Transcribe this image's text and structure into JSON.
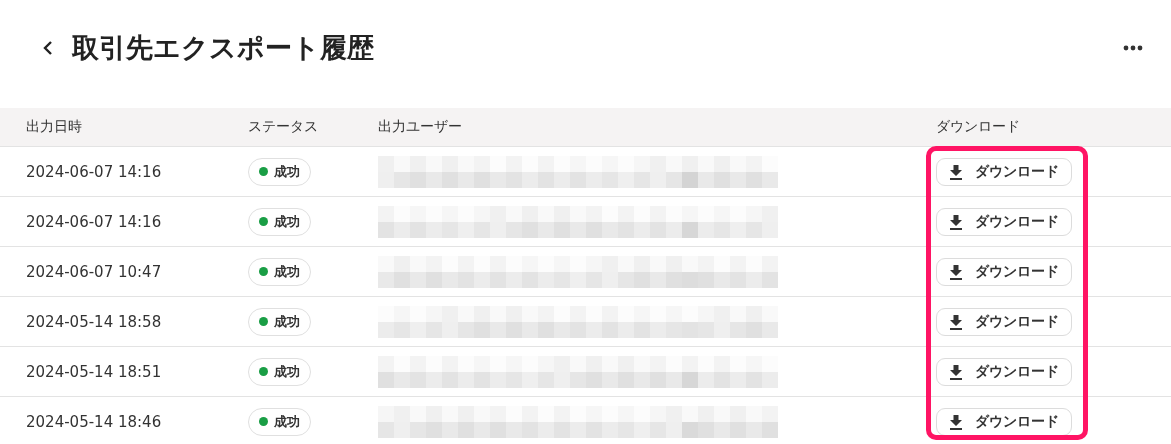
{
  "header": {
    "title": "取引先エクスポート履歴"
  },
  "table": {
    "columns": [
      "出力日時",
      "ステータス",
      "出力ユーザー",
      "ダウンロード"
    ],
    "rows": [
      {
        "date": "2024-06-07 14:16",
        "status": {
          "label": "成功",
          "kind": "success"
        },
        "download": "ダウンロード"
      },
      {
        "date": "2024-06-07 14:16",
        "status": {
          "label": "成功",
          "kind": "success"
        },
        "download": "ダウンロード"
      },
      {
        "date": "2024-06-07 10:47",
        "status": {
          "label": "成功",
          "kind": "success"
        },
        "download": "ダウンロード"
      },
      {
        "date": "2024-05-14 18:58",
        "status": {
          "label": "成功",
          "kind": "success"
        },
        "download": "ダウンロード"
      },
      {
        "date": "2024-05-14 18:51",
        "status": {
          "label": "成功",
          "kind": "success"
        },
        "download": "ダウンロード"
      },
      {
        "date": "2024-05-14 18:46",
        "status": {
          "label": "成功",
          "kind": "success"
        },
        "download": "ダウンロード"
      }
    ]
  }
}
